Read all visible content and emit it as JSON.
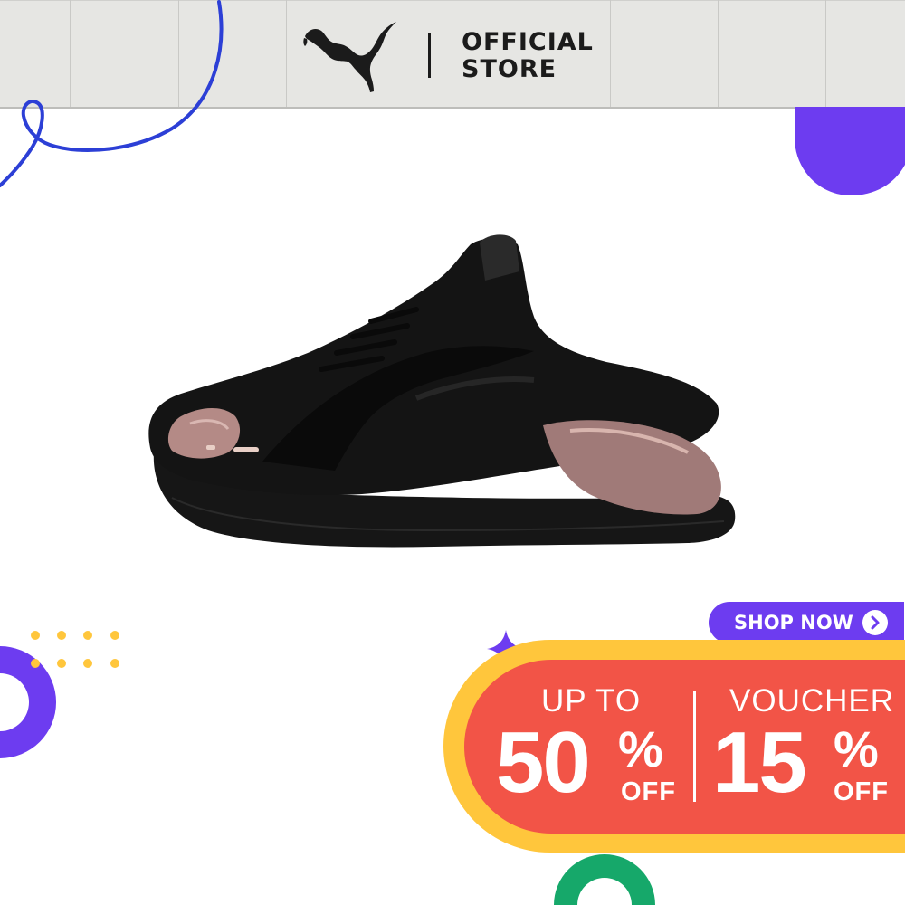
{
  "header": {
    "brand_logo": "puma-cat-logo",
    "store_line1": "OFFICIAL",
    "store_line2": "STORE"
  },
  "product": {
    "image": "black-sneaker-rose-gold-accents"
  },
  "promo": {
    "shop_now_label": "SHOP NOW",
    "shop_now_icon": "chevron-right-icon",
    "left": {
      "prefix": "UP TO",
      "value": "50",
      "percent": "%",
      "suffix": "OFF"
    },
    "right": {
      "prefix": "VOUCHER",
      "value": "15",
      "percent": "%",
      "suffix": "OFF"
    }
  },
  "colors": {
    "header_bg": "#e6e6e3",
    "accent_purple": "#6d3cf0",
    "accent_blue": "#2c3fd6",
    "promo_yellow": "#ffc63c",
    "promo_red": "#f25447",
    "ring_green": "#16a86a",
    "dots_yellow": "#ffc63c"
  }
}
